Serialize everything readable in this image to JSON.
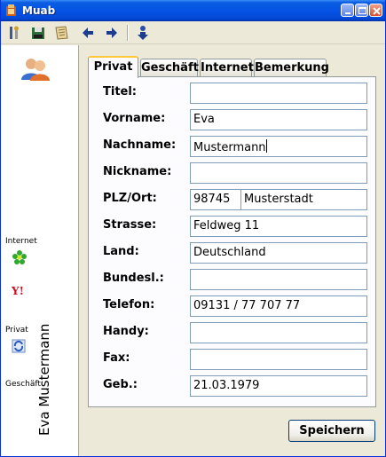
{
  "window": {
    "title": "Muab"
  },
  "toolbar": {
    "icons": [
      "tools-icon",
      "save-disk-icon",
      "notes-icon",
      "arrow-left-icon",
      "arrow-right-icon",
      "download-icon"
    ]
  },
  "sidebar": {
    "contact_icon": "contacts-icon",
    "links": [
      {
        "label": "Internet",
        "icon": "icq-flower-icon"
      },
      {
        "label": "",
        "icon": "yahoo-icon"
      },
      {
        "label": "Privat",
        "icon": "sync-icon"
      },
      {
        "label": "Geschäft",
        "icon": ""
      }
    ],
    "vertical_name": "Eva Mustermann"
  },
  "tabs": [
    {
      "label": "Privat",
      "active": true
    },
    {
      "label": "Geschäft",
      "active": false
    },
    {
      "label": "Internet",
      "active": false
    },
    {
      "label": "Bemerkung",
      "active": false
    }
  ],
  "form": {
    "titel": {
      "label": "Titel:",
      "value": ""
    },
    "vorname": {
      "label": "Vorname:",
      "value": "Eva"
    },
    "nachname": {
      "label": "Nachname:",
      "value": "Mustermann"
    },
    "nickname": {
      "label": "Nickname:",
      "value": ""
    },
    "plzort": {
      "label": "PLZ/Ort:",
      "plz": "98745",
      "ort": "Musterstadt"
    },
    "strasse": {
      "label": "Strasse:",
      "value": "Feldweg 11"
    },
    "land": {
      "label": "Land:",
      "value": "Deutschland"
    },
    "bundesland": {
      "label": "Bundesl.:",
      "value": ""
    },
    "telefon": {
      "label": "Telefon:",
      "value": "09131 / 77 707 77"
    },
    "handy": {
      "label": "Handy:",
      "value": ""
    },
    "fax": {
      "label": "Fax:",
      "value": ""
    },
    "geb": {
      "label": "Geb.:",
      "value": "21.03.1979"
    }
  },
  "buttons": {
    "save": "Speichern"
  },
  "colors": {
    "titlebar": "#0554e6",
    "panel_bg": "#fcfcfe",
    "input_border": "#7f9db9",
    "active_tab_accent": "#ffc83c"
  }
}
